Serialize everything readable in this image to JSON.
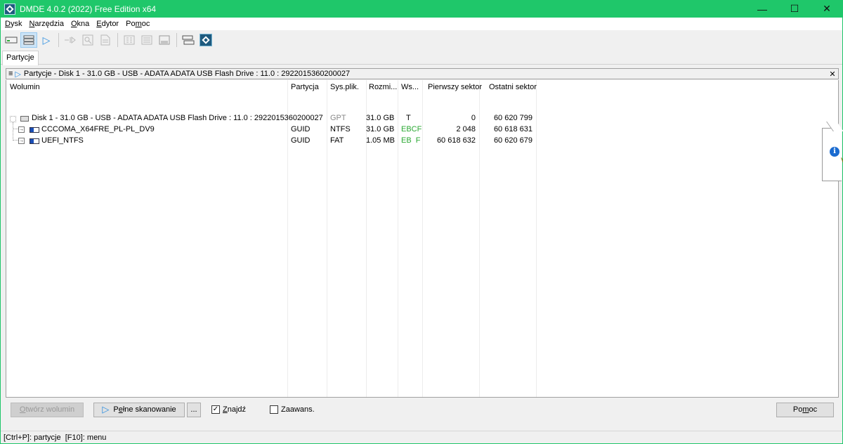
{
  "window": {
    "title": "DMDE 4.0.2 (2022) Free Edition x64",
    "controls": {
      "minimize": "—",
      "maximize": "☐",
      "close": "✕"
    },
    "accent_color": "#1fc76a"
  },
  "menu": {
    "items": [
      {
        "underline": "D",
        "rest": "ysk"
      },
      {
        "underline": "N",
        "rest": "arzędzia"
      },
      {
        "underline": "O",
        "rest": "kna"
      },
      {
        "underline": "E",
        "rest": "dytor"
      },
      {
        "pre": "Po",
        "underline": "m",
        "rest": "oc"
      }
    ]
  },
  "toolbar": {
    "icons": [
      "disk-icon",
      "partitions-icon",
      "play-icon",
      "skip-icon",
      "search-icon",
      "file-icon",
      "grid-icon",
      "list-icon",
      "table-icon",
      "split-icon",
      "brand-icon"
    ]
  },
  "tabs": [
    {
      "label": "Partycje"
    }
  ],
  "panel": {
    "menu_glyph": "≡",
    "play_glyph": "▷",
    "title": "Partycje - Disk 1 - 31.0 GB - USB - ADATA ADATA USB Flash Drive : 11.0 : 2922015360200027",
    "close_glyph": "✕"
  },
  "table": {
    "columns": [
      "Wolumin",
      "Partycja",
      "Sys.plik.",
      "Rozmi...",
      "Ws...",
      "Pierwszy sektor",
      "Ostatni sektor"
    ],
    "rows": [
      {
        "name": "Disk 1 - 31.0 GB - USB - ADATA ADATA USB Flash Drive : 11.0 : 2922015360200027",
        "partition": "",
        "fs": "GPT",
        "size": "31.0 GB",
        "ws": "T",
        "first": "0",
        "last": "60 620 799"
      },
      {
        "name": "CCCOMA_X64FRE_PL-PL_DV9",
        "partition": "GUID",
        "fs": "NTFS",
        "size": "31.0 GB",
        "ws": "EBCF",
        "first": "2 048",
        "last": "60 618 631"
      },
      {
        "name": "UEFI_NTFS",
        "partition": "GUID",
        "fs": "FAT",
        "size": "1.05 MB",
        "ws": "EB  F",
        "first": "60 618 632",
        "last": "60 620 679"
      }
    ]
  },
  "bottom": {
    "open_volume": {
      "underline": "O",
      "rest": "twórz wolumin"
    },
    "full_scan": {
      "pre": "P",
      "underline": "e",
      "rest": "łne skanowanie"
    },
    "more": "...",
    "find": {
      "label_underline": "Z",
      "label_rest": "najdź",
      "checked": true
    },
    "advanced": {
      "label_pre": "Zaawans.",
      "checked": false
    },
    "help": {
      "pre": "Po",
      "underline": "m",
      "rest": "oc"
    },
    "check_glyph": "✓"
  },
  "status": {
    "text": "[Ctrl+P]: partycje  [F10]: menu"
  },
  "tooltip": {
    "icon_glyph": "i",
    "fragment": "V"
  }
}
